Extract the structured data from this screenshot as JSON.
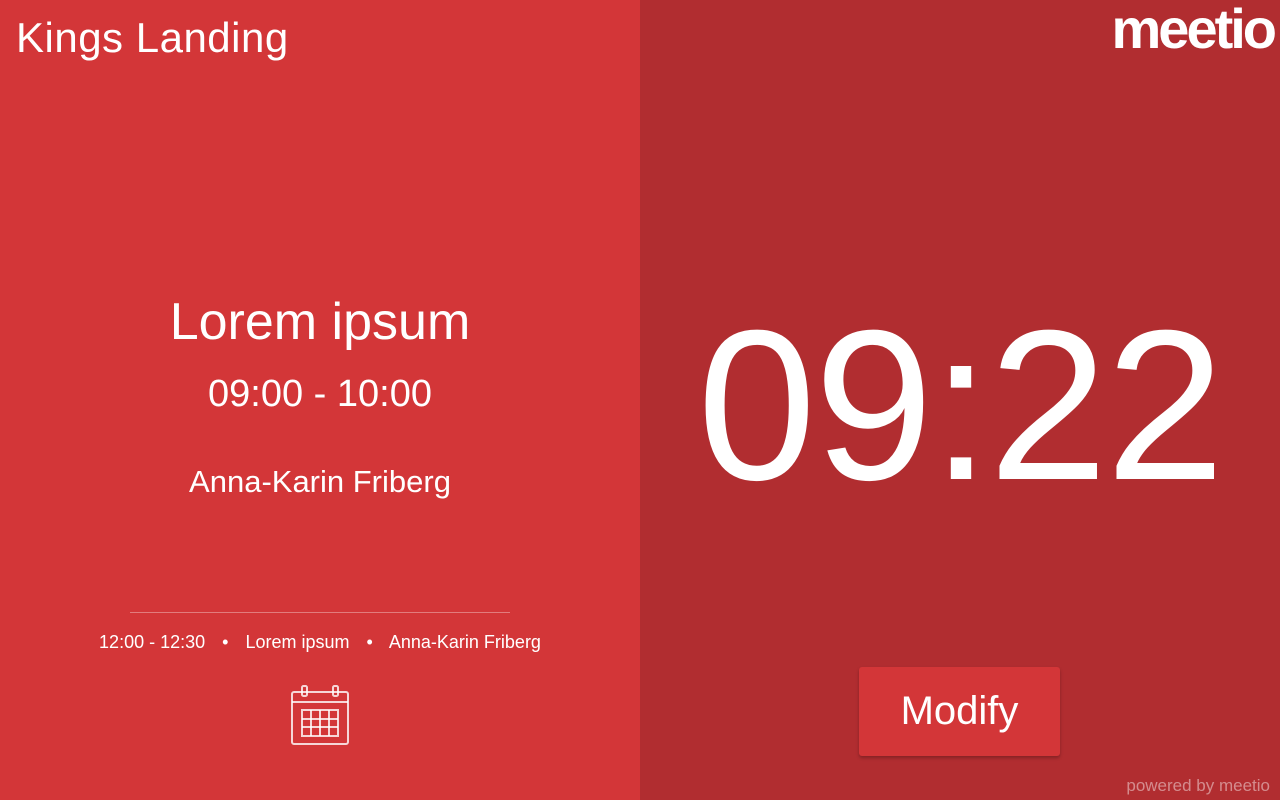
{
  "room": {
    "name": "Kings Landing"
  },
  "current_meeting": {
    "title": "Lorem ipsum",
    "time": "09:00 - 10:00",
    "organizer": "Anna-Karin Friberg"
  },
  "next_meeting": {
    "time": "12:00 - 12:30",
    "title": "Lorem ipsum",
    "organizer": "Anna-Karin Friberg",
    "separator": "•"
  },
  "calendar": {
    "icon": "calendar-icon"
  },
  "brand": {
    "logo": "meetio",
    "powered_by": "powered by meetio"
  },
  "clock": {
    "time": "09:22"
  },
  "actions": {
    "modify_label": "Modify"
  },
  "colors": {
    "left_panel": "#d33638",
    "right_panel": "#b12d30",
    "text": "#ffffff"
  }
}
